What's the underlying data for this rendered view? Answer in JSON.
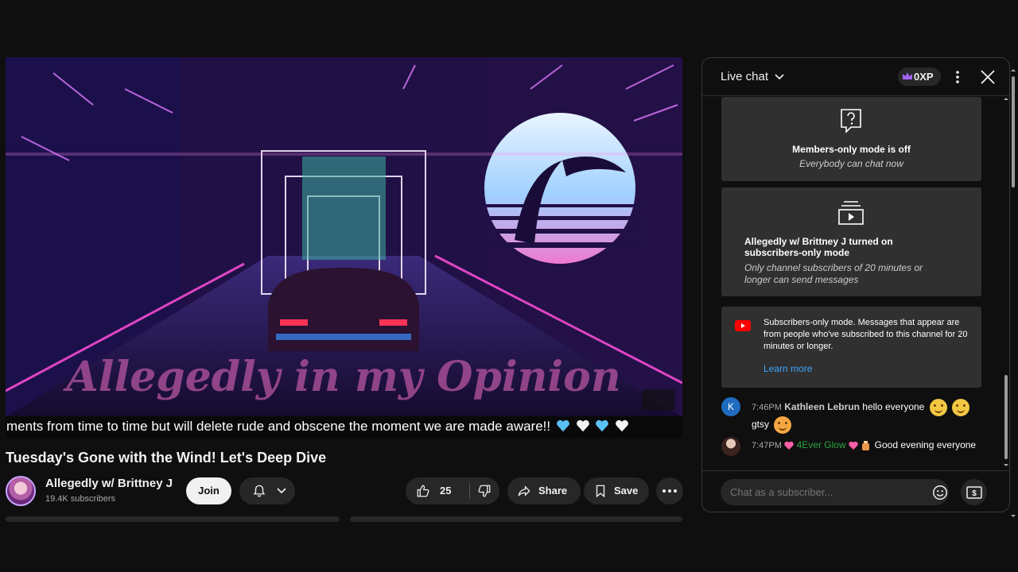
{
  "video": {
    "overlay_text": "Allegedly in my Opinion",
    "caption": "ments from time to time but will delete rude and obscene the moment we are made aware!!"
  },
  "video_title": "Tuesday's Gone with the Wind! Let's Deep Dive",
  "channel": {
    "name": "Allegedly w/ Brittney J",
    "subscribers": "19.4K subscribers",
    "join_label": "Join"
  },
  "actions": {
    "like_count": "25",
    "share_label": "Share",
    "save_label": "Save"
  },
  "chat": {
    "header_title": "Live chat",
    "xp": "0XP",
    "members_mode": {
      "title": "Members-only mode is off",
      "subtitle": "Everybody can chat now"
    },
    "subscribers_mode": {
      "title": "Allegedly w/ Brittney J turned on subscribers-only mode",
      "subtitle": "Only channel subscribers of 20 minutes or longer can send messages"
    },
    "notice": {
      "text": "Subscribers-only mode. Messages that appear are from people who've subscribed to this channel for 20 minutes or longer.",
      "link": "Learn more"
    },
    "messages": [
      {
        "avatar_letter": "K",
        "time": "7:46PM",
        "author": "Kathleen Lebrun",
        "text": "hello everyone",
        "text2": "gtsy"
      },
      {
        "time": "7:47PM",
        "author": "4Ever Glow",
        "text": "Good evening everyone"
      }
    ],
    "input_placeholder": "Chat as a subscriber..."
  },
  "colors": {
    "background": "#0f0f0f",
    "card": "#303030",
    "link": "#3ea6ff",
    "author_green": "#2ba640",
    "youtube_red": "#ff0000"
  }
}
